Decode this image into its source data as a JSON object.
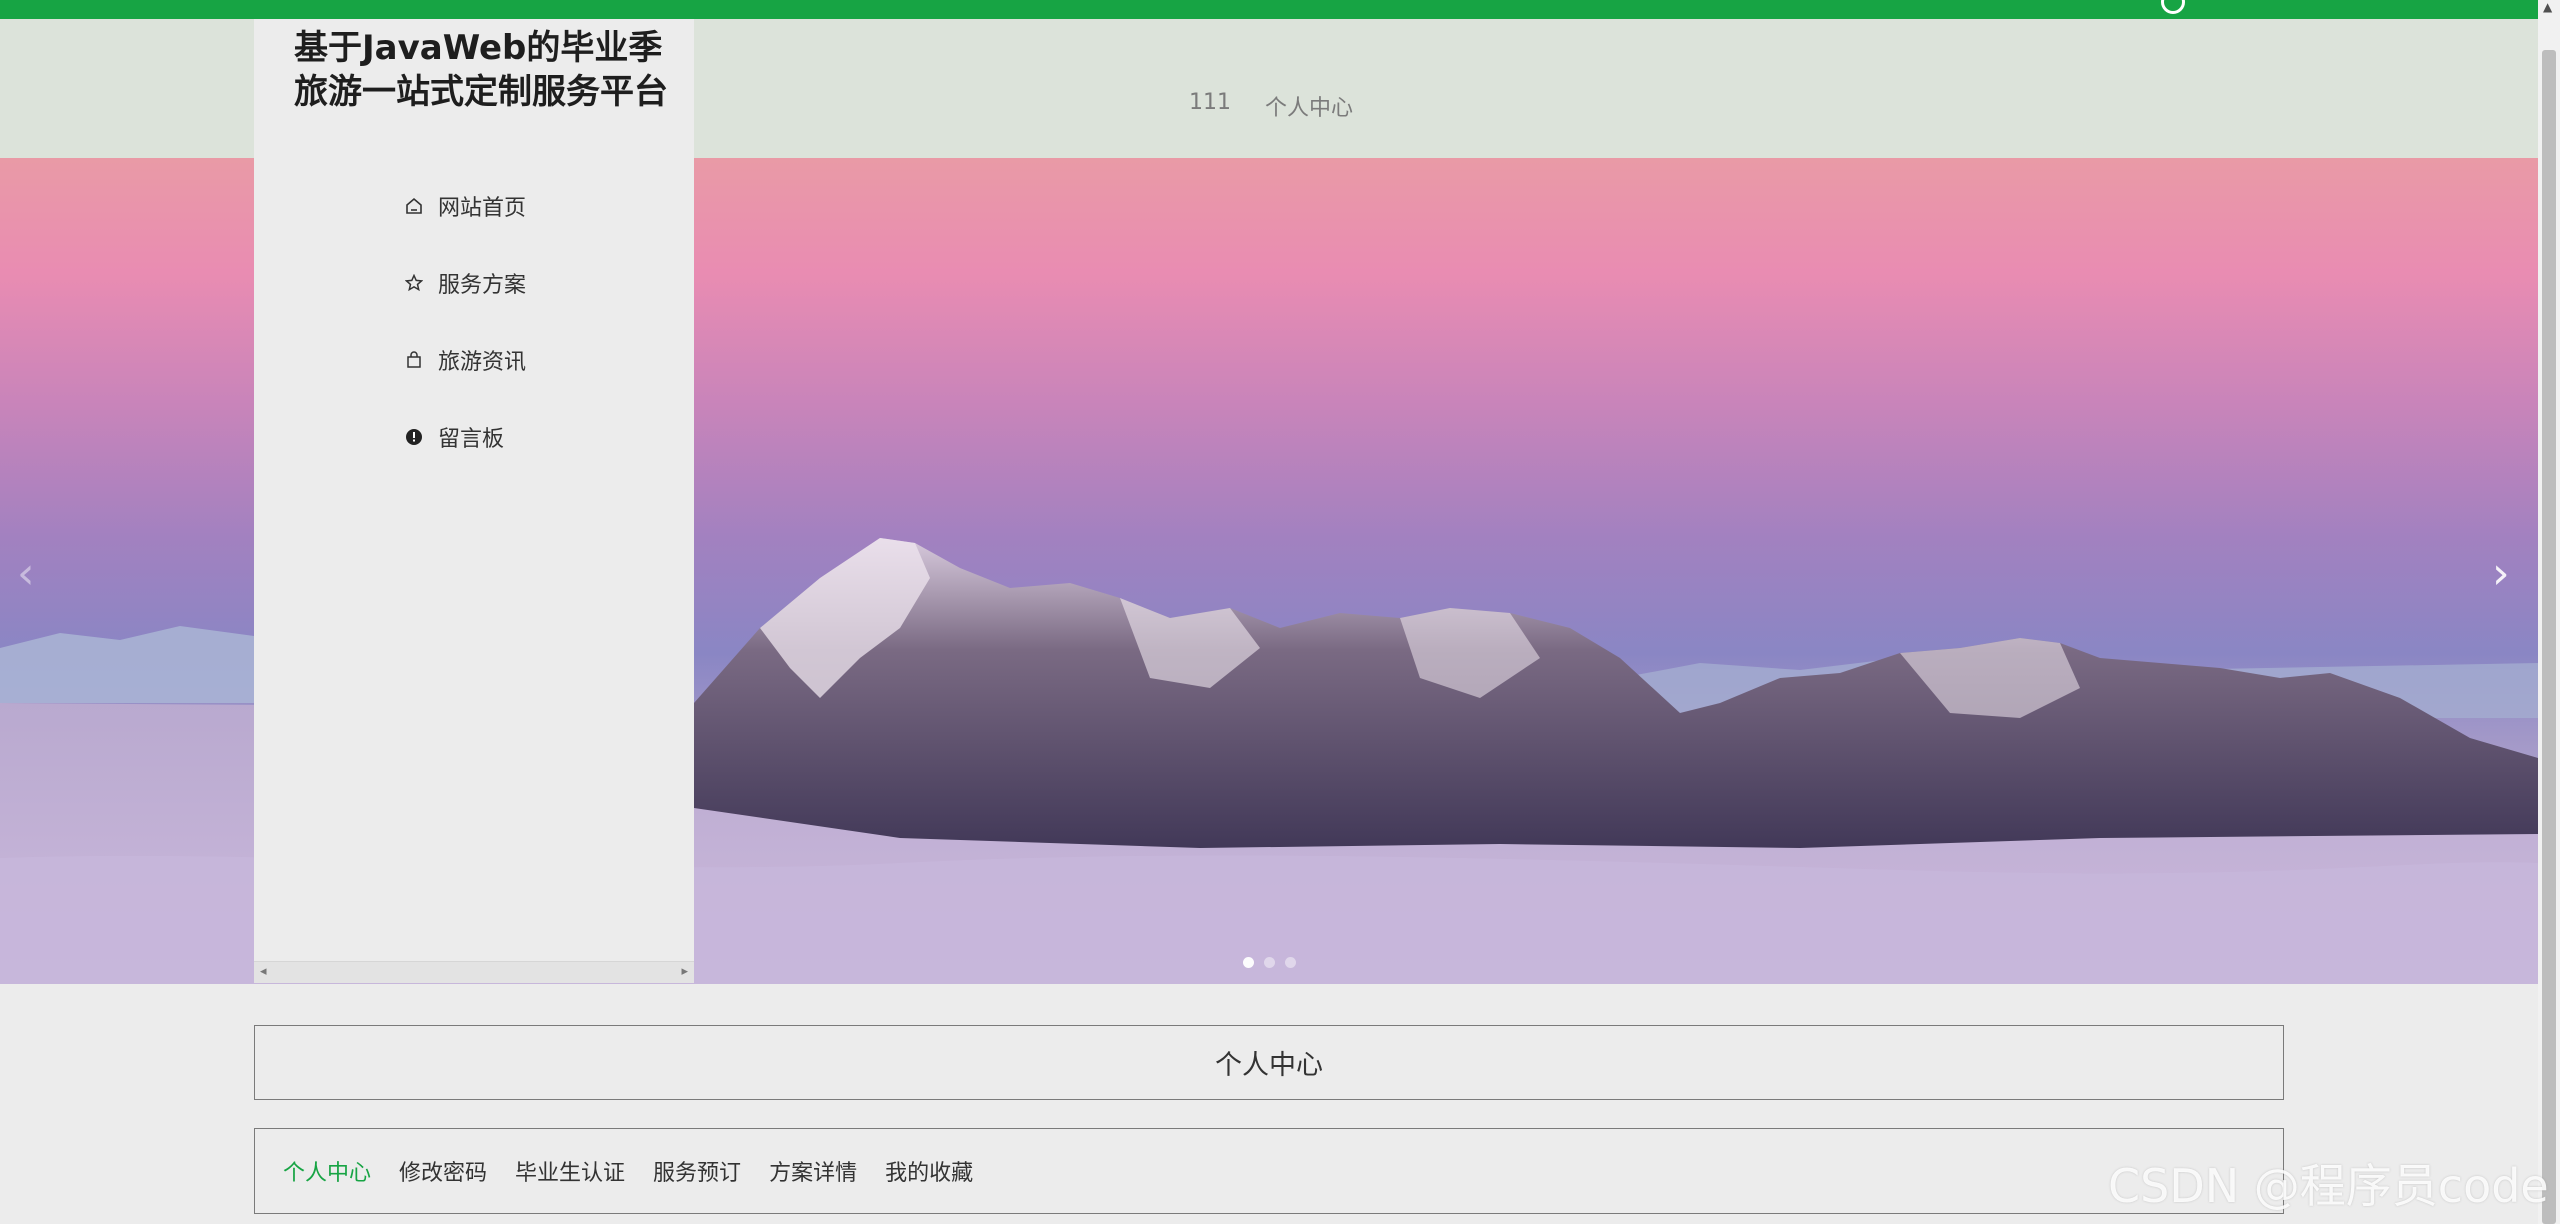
{
  "site": {
    "title": "基于JavaWeb的毕业季旅游一站式定制服务平台"
  },
  "header": {
    "links": [
      {
        "label": "111"
      },
      {
        "label": "个人中心"
      }
    ]
  },
  "sidebar": {
    "items": [
      {
        "label": "网站首页",
        "icon": "home-icon"
      },
      {
        "label": "服务方案",
        "icon": "star-icon"
      },
      {
        "label": "旅游资讯",
        "icon": "bag-icon"
      },
      {
        "label": "留言板",
        "icon": "alert-icon"
      }
    ]
  },
  "carousel": {
    "prev": "‹",
    "next": "›",
    "slide_count": 3,
    "active_slide": 1
  },
  "center": {
    "title": "个人中心"
  },
  "tabs": [
    {
      "label": "个人中心",
      "active": true
    },
    {
      "label": "修改密码",
      "active": false
    },
    {
      "label": "毕业生认证",
      "active": false
    },
    {
      "label": "服务预订",
      "active": false
    },
    {
      "label": "方案详情",
      "active": false
    },
    {
      "label": "我的收藏",
      "active": false
    }
  ],
  "watermark": "CSDN @程序员code",
  "colors": {
    "brand_green": "#17a444",
    "header_bg": "#dce3da",
    "page_bg": "#ececec"
  }
}
